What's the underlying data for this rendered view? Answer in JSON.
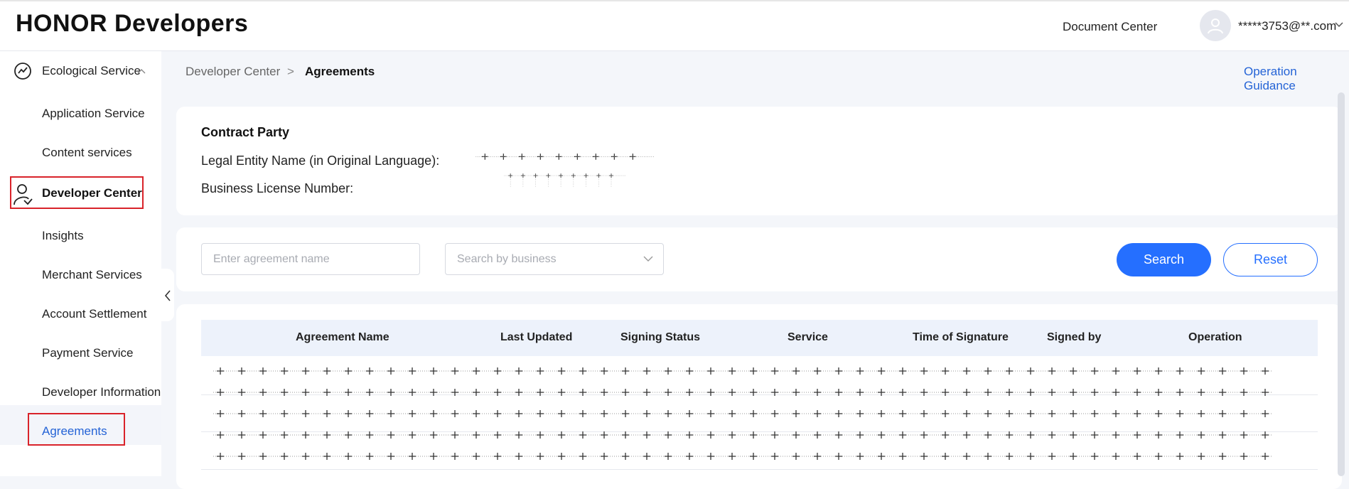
{
  "header": {
    "logo": "HONOR Developers",
    "doc_center": "Document Center",
    "user_email": "*****3753@**.com"
  },
  "sidebar": {
    "ecological": "Ecological Service",
    "items_top": [
      "Application Service",
      "Content services"
    ],
    "developer_center": "Developer Center",
    "items_dev": [
      "Insights",
      "Merchant Services",
      "Account Settlement",
      "Payment Service",
      "Developer Information",
      "Agreements"
    ]
  },
  "breadcrumb": {
    "parent": "Developer Center",
    "separator": ">",
    "current": "Agreements"
  },
  "operation_guidance": "Operation Guidance",
  "contract_party": {
    "title": "Contract Party",
    "legal_entity_label": "Legal Entity Name (in Original Language):",
    "business_license_label": "Business License Number:"
  },
  "filters": {
    "agreement_placeholder": "Enter agreement name",
    "business_placeholder": "Search by business",
    "search_label": "Search",
    "reset_label": "Reset"
  },
  "table": {
    "columns": [
      "Agreement Name",
      "Last Updated",
      "Signing Status",
      "Service",
      "Time of Signature",
      "Signed by",
      "Operation"
    ]
  },
  "colors": {
    "accent": "#256fff",
    "link": "#2463d6",
    "highlight_box": "#d9232a"
  }
}
